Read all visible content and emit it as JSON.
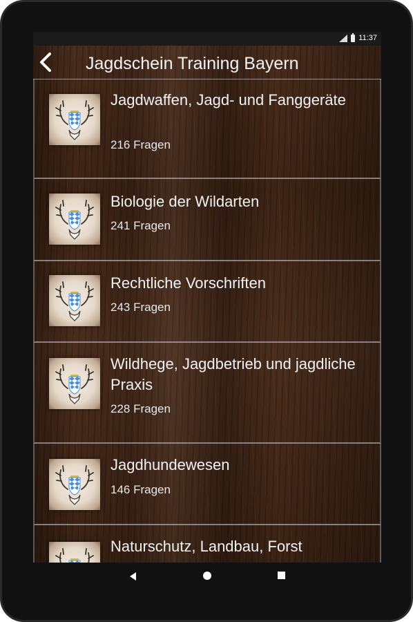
{
  "status": {
    "time": "11:37"
  },
  "appbar": {
    "title": "Jagdschein Training Bayern"
  },
  "topics": [
    {
      "title": "Jagdwaffen, Jagd- und Fanggeräte",
      "count": "216 Fragen"
    },
    {
      "title": "Biologie der Wildarten",
      "count": "241 Fragen"
    },
    {
      "title": "Rechtliche Vorschriften",
      "count": "243 Fragen"
    },
    {
      "title": "Wildhege, Jagdbetrieb und jagdliche Praxis",
      "count": "228 Fragen"
    },
    {
      "title": "Jagdhundewesen",
      "count": "146 Fragen"
    },
    {
      "title": "Naturschutz, Landbau, Forst",
      "count": ""
    }
  ],
  "icons": {
    "back": "chevron-left-icon",
    "topic": "deer-antler-crest-icon",
    "nav_back": "triangle-back-icon",
    "nav_home": "circle-home-icon",
    "nav_recent": "square-recent-icon"
  },
  "colors": {
    "text": "#f2f2f2",
    "crest_blue": "#4a90d9",
    "crest_gold": "#d8b74a"
  }
}
